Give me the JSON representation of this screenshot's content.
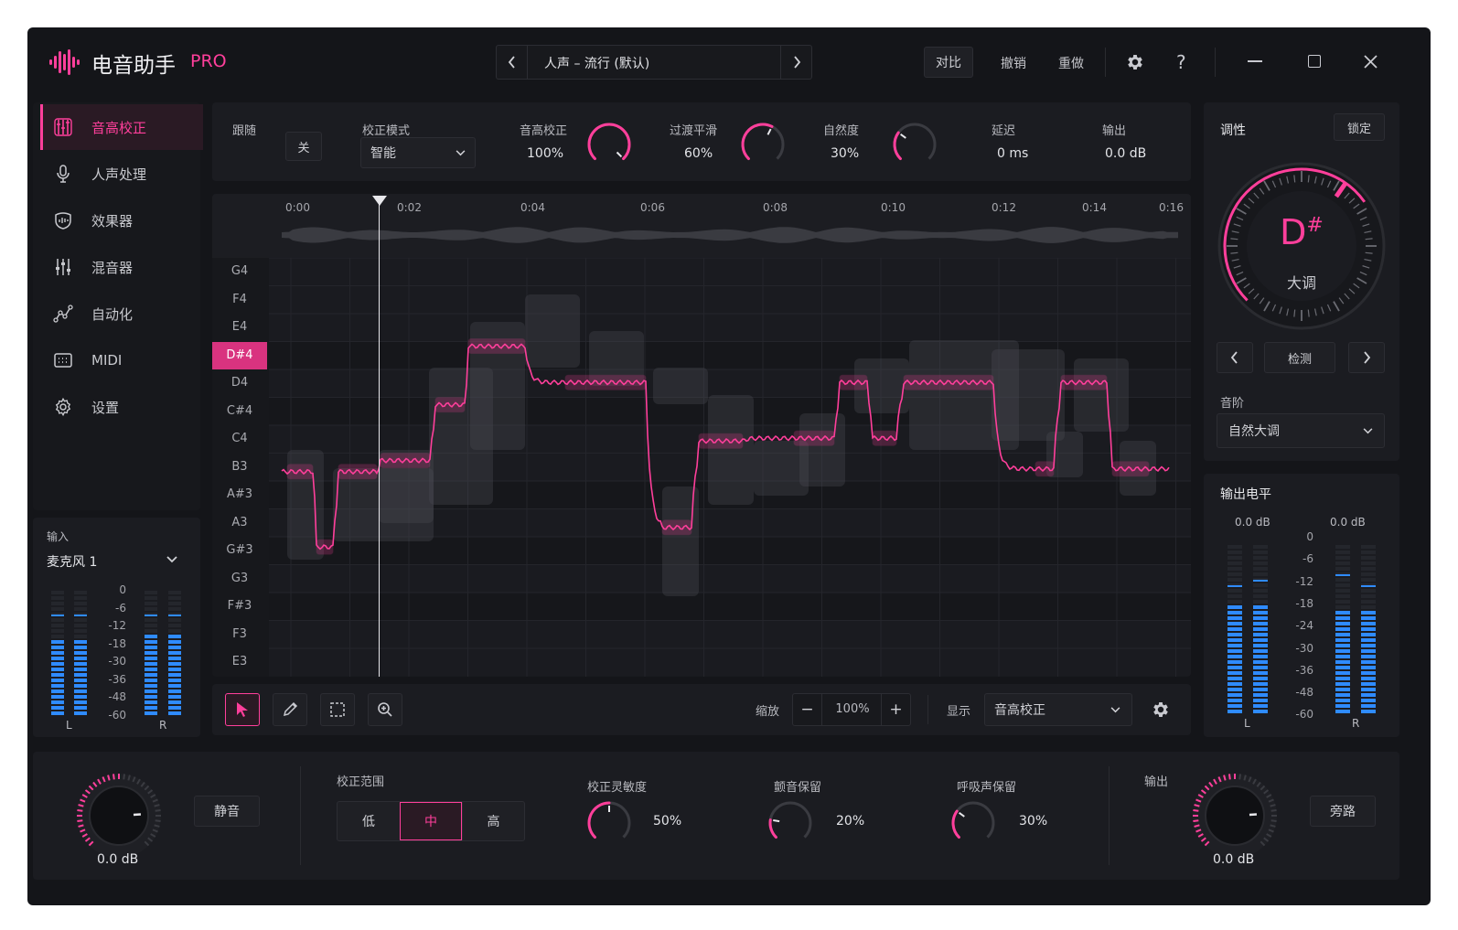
{
  "app": {
    "title": "电音助手",
    "edition": "PRO",
    "preset": "人声 – 流行 (默认)",
    "compare": "对比",
    "undo": "撤销",
    "redo": "重做",
    "help": "?"
  },
  "sidebar": {
    "items": [
      {
        "label": "音高校正",
        "icon": "pitch-icon"
      },
      {
        "label": "人声处理",
        "icon": "microphone-icon"
      },
      {
        "label": "效果器",
        "icon": "effects-icon"
      },
      {
        "label": "混音器",
        "icon": "mixer-icon"
      },
      {
        "label": "自动化",
        "icon": "automation-icon"
      },
      {
        "label": "MIDI",
        "icon": "midi-icon"
      },
      {
        "label": "设置",
        "icon": "gear-icon"
      }
    ],
    "input_label": "输入",
    "input_device": "麦克风 1",
    "meter_scale": [
      "0",
      "-6",
      "-12",
      "-18",
      "-30",
      "-36",
      "-48",
      "-60"
    ],
    "meter_left": "L",
    "meter_right": "R",
    "input_level_left": 0.62,
    "input_level_right": 0.66
  },
  "controls": {
    "follow_label": "跟随",
    "follow_value": "关",
    "mode_label": "校正模式",
    "mode_value": "智能",
    "pitch_label": "音高校正",
    "pitch_value": "100%",
    "pitch_amount": 1.0,
    "transition_label": "过渡平滑",
    "transition_value": "60%",
    "transition_amount": 0.6,
    "natural_label": "自然度",
    "natural_value": "30%",
    "natural_amount": 0.3,
    "latency_label": "延迟",
    "latency_value": "0 ms",
    "output_label": "输出",
    "output_value": "0.0 dB"
  },
  "timeline": {
    "ticks": [
      "0:00",
      "0:02",
      "0:04",
      "0:06",
      "0:08",
      "0:10",
      "0:12",
      "0:14",
      "0:16"
    ],
    "notes": [
      "G4",
      "F4",
      "E4",
      "D#4",
      "D4",
      "C#4",
      "C4",
      "B3",
      "A#3",
      "A3",
      "G#3",
      "G3",
      "F#3",
      "F3",
      "E3"
    ],
    "active_note": "D#4"
  },
  "toolbar": {
    "zoom_label": "缩放",
    "zoom_value": "100%",
    "minus": "−",
    "plus": "+",
    "display_label": "显示",
    "display_value": "音高校正"
  },
  "key_panel": {
    "title": "调性",
    "lock": "锁定",
    "key": "D",
    "accidental": "#",
    "mode": "大调",
    "detect": "检测",
    "scale_label": "音阶",
    "scale_value": "自然大调"
  },
  "output_panel": {
    "title": "输出电平",
    "left_db": "0.0 dB",
    "right_db": "0.0 dB",
    "scale": [
      "0",
      "-6",
      "-12",
      "-18",
      "-24",
      "-30",
      "-36",
      "-48",
      "-60"
    ],
    "left": "L",
    "right": "R",
    "level_left": 0.66,
    "level_right": 0.61
  },
  "bottom": {
    "input_gain": "0.0 dB",
    "mute": "静音",
    "range_label": "校正范围",
    "range_options": [
      "低",
      "中",
      "高"
    ],
    "range_selected": "中",
    "sensitivity_label": "校正灵敏度",
    "sensitivity_value": "50%",
    "sensitivity_amount": 0.5,
    "vibrato_label": "颤音保留",
    "vibrato_value": "20%",
    "vibrato_amount": 0.2,
    "breath_label": "呼吸声保留",
    "breath_value": "30%",
    "breath_amount": 0.3,
    "output_label": "输出",
    "output_gain": "0.0 dB",
    "bypass": "旁路"
  },
  "colors": {
    "accent": "#ff3f9b",
    "meter": "#2f8bff",
    "background": "#141519",
    "panel": "#1b1c21"
  }
}
